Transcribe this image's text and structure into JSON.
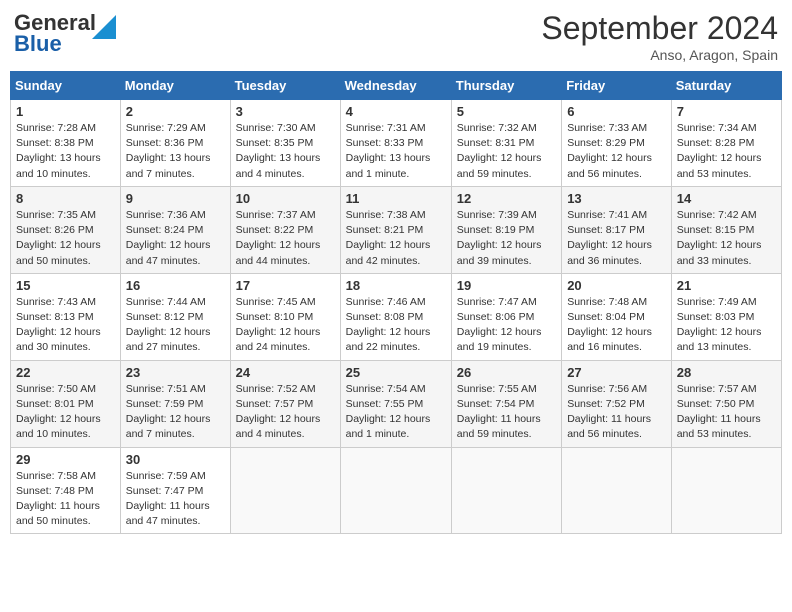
{
  "header": {
    "logo_line1": "General",
    "logo_line2": "Blue",
    "month": "September 2024",
    "location": "Anso, Aragon, Spain"
  },
  "weekdays": [
    "Sunday",
    "Monday",
    "Tuesday",
    "Wednesday",
    "Thursday",
    "Friday",
    "Saturday"
  ],
  "weeks": [
    [
      {
        "day": "1",
        "lines": [
          "Sunrise: 7:28 AM",
          "Sunset: 8:38 PM",
          "Daylight: 13 hours",
          "and 10 minutes."
        ]
      },
      {
        "day": "2",
        "lines": [
          "Sunrise: 7:29 AM",
          "Sunset: 8:36 PM",
          "Daylight: 13 hours",
          "and 7 minutes."
        ]
      },
      {
        "day": "3",
        "lines": [
          "Sunrise: 7:30 AM",
          "Sunset: 8:35 PM",
          "Daylight: 13 hours",
          "and 4 minutes."
        ]
      },
      {
        "day": "4",
        "lines": [
          "Sunrise: 7:31 AM",
          "Sunset: 8:33 PM",
          "Daylight: 13 hours",
          "and 1 minute."
        ]
      },
      {
        "day": "5",
        "lines": [
          "Sunrise: 7:32 AM",
          "Sunset: 8:31 PM",
          "Daylight: 12 hours",
          "and 59 minutes."
        ]
      },
      {
        "day": "6",
        "lines": [
          "Sunrise: 7:33 AM",
          "Sunset: 8:29 PM",
          "Daylight: 12 hours",
          "and 56 minutes."
        ]
      },
      {
        "day": "7",
        "lines": [
          "Sunrise: 7:34 AM",
          "Sunset: 8:28 PM",
          "Daylight: 12 hours",
          "and 53 minutes."
        ]
      }
    ],
    [
      {
        "day": "8",
        "lines": [
          "Sunrise: 7:35 AM",
          "Sunset: 8:26 PM",
          "Daylight: 12 hours",
          "and 50 minutes."
        ]
      },
      {
        "day": "9",
        "lines": [
          "Sunrise: 7:36 AM",
          "Sunset: 8:24 PM",
          "Daylight: 12 hours",
          "and 47 minutes."
        ]
      },
      {
        "day": "10",
        "lines": [
          "Sunrise: 7:37 AM",
          "Sunset: 8:22 PM",
          "Daylight: 12 hours",
          "and 44 minutes."
        ]
      },
      {
        "day": "11",
        "lines": [
          "Sunrise: 7:38 AM",
          "Sunset: 8:21 PM",
          "Daylight: 12 hours",
          "and 42 minutes."
        ]
      },
      {
        "day": "12",
        "lines": [
          "Sunrise: 7:39 AM",
          "Sunset: 8:19 PM",
          "Daylight: 12 hours",
          "and 39 minutes."
        ]
      },
      {
        "day": "13",
        "lines": [
          "Sunrise: 7:41 AM",
          "Sunset: 8:17 PM",
          "Daylight: 12 hours",
          "and 36 minutes."
        ]
      },
      {
        "day": "14",
        "lines": [
          "Sunrise: 7:42 AM",
          "Sunset: 8:15 PM",
          "Daylight: 12 hours",
          "and 33 minutes."
        ]
      }
    ],
    [
      {
        "day": "15",
        "lines": [
          "Sunrise: 7:43 AM",
          "Sunset: 8:13 PM",
          "Daylight: 12 hours",
          "and 30 minutes."
        ]
      },
      {
        "day": "16",
        "lines": [
          "Sunrise: 7:44 AM",
          "Sunset: 8:12 PM",
          "Daylight: 12 hours",
          "and 27 minutes."
        ]
      },
      {
        "day": "17",
        "lines": [
          "Sunrise: 7:45 AM",
          "Sunset: 8:10 PM",
          "Daylight: 12 hours",
          "and 24 minutes."
        ]
      },
      {
        "day": "18",
        "lines": [
          "Sunrise: 7:46 AM",
          "Sunset: 8:08 PM",
          "Daylight: 12 hours",
          "and 22 minutes."
        ]
      },
      {
        "day": "19",
        "lines": [
          "Sunrise: 7:47 AM",
          "Sunset: 8:06 PM",
          "Daylight: 12 hours",
          "and 19 minutes."
        ]
      },
      {
        "day": "20",
        "lines": [
          "Sunrise: 7:48 AM",
          "Sunset: 8:04 PM",
          "Daylight: 12 hours",
          "and 16 minutes."
        ]
      },
      {
        "day": "21",
        "lines": [
          "Sunrise: 7:49 AM",
          "Sunset: 8:03 PM",
          "Daylight: 12 hours",
          "and 13 minutes."
        ]
      }
    ],
    [
      {
        "day": "22",
        "lines": [
          "Sunrise: 7:50 AM",
          "Sunset: 8:01 PM",
          "Daylight: 12 hours",
          "and 10 minutes."
        ]
      },
      {
        "day": "23",
        "lines": [
          "Sunrise: 7:51 AM",
          "Sunset: 7:59 PM",
          "Daylight: 12 hours",
          "and 7 minutes."
        ]
      },
      {
        "day": "24",
        "lines": [
          "Sunrise: 7:52 AM",
          "Sunset: 7:57 PM",
          "Daylight: 12 hours",
          "and 4 minutes."
        ]
      },
      {
        "day": "25",
        "lines": [
          "Sunrise: 7:54 AM",
          "Sunset: 7:55 PM",
          "Daylight: 12 hours",
          "and 1 minute."
        ]
      },
      {
        "day": "26",
        "lines": [
          "Sunrise: 7:55 AM",
          "Sunset: 7:54 PM",
          "Daylight: 11 hours",
          "and 59 minutes."
        ]
      },
      {
        "day": "27",
        "lines": [
          "Sunrise: 7:56 AM",
          "Sunset: 7:52 PM",
          "Daylight: 11 hours",
          "and 56 minutes."
        ]
      },
      {
        "day": "28",
        "lines": [
          "Sunrise: 7:57 AM",
          "Sunset: 7:50 PM",
          "Daylight: 11 hours",
          "and 53 minutes."
        ]
      }
    ],
    [
      {
        "day": "29",
        "lines": [
          "Sunrise: 7:58 AM",
          "Sunset: 7:48 PM",
          "Daylight: 11 hours",
          "and 50 minutes."
        ]
      },
      {
        "day": "30",
        "lines": [
          "Sunrise: 7:59 AM",
          "Sunset: 7:47 PM",
          "Daylight: 11 hours",
          "and 47 minutes."
        ]
      },
      null,
      null,
      null,
      null,
      null
    ]
  ]
}
